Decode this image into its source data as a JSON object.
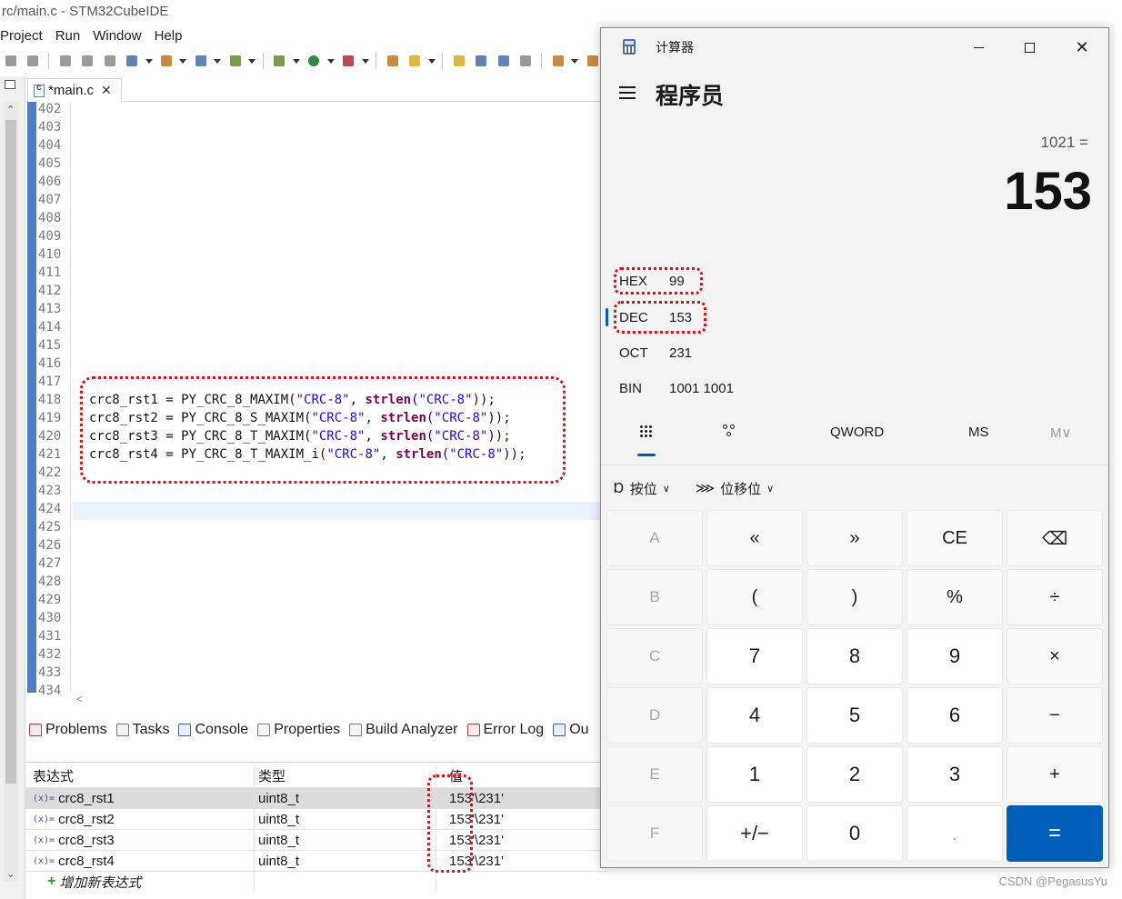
{
  "ide": {
    "title": "rc/main.c - STM32CubeIDE",
    "menu": [
      "Project",
      "Run",
      "Window",
      "Help"
    ],
    "editor_tab": "*main.c",
    "line_numbers": [
      "402",
      "403",
      "404",
      "405",
      "406",
      "407",
      "408",
      "409",
      "410",
      "411",
      "412",
      "413",
      "414",
      "415",
      "416",
      "417",
      "418",
      "419",
      "420",
      "421",
      "422",
      "423",
      "424",
      "425",
      "426",
      "427",
      "428",
      "429",
      "430",
      "431",
      "432",
      "433",
      "434"
    ],
    "code_lines": [
      {
        "line": "418",
        "var": "crc8_rst1",
        "fn": "PY_CRC_8_MAXIM"
      },
      {
        "line": "419",
        "var": "crc8_rst2",
        "fn": "PY_CRC_8_S_MAXIM"
      },
      {
        "line": "420",
        "var": "crc8_rst3",
        "fn": "PY_CRC_8_T_MAXIM"
      },
      {
        "line": "421",
        "var": "crc8_rst4",
        "fn": "PY_CRC_8_T_MAXIM_i"
      }
    ],
    "code_str": "\"CRC-8\"",
    "code_kw": "strlen",
    "panel_tabs": [
      "Problems",
      "Tasks",
      "Console",
      "Properties",
      "Build Analyzer",
      "Error Log",
      "Ou"
    ],
    "watch": {
      "headers": [
        "表达式",
        "类型",
        "值"
      ],
      "rows": [
        {
          "name": "crc8_rst1",
          "type": "uint8_t",
          "value": "153",
          "char": "'\\231'"
        },
        {
          "name": "crc8_rst2",
          "type": "uint8_t",
          "value": "153",
          "char": "'\\231'"
        },
        {
          "name": "crc8_rst3",
          "type": "uint8_t",
          "value": "153",
          "char": "'\\231'"
        },
        {
          "name": "crc8_rst4",
          "type": "uint8_t",
          "value": "153",
          "char": "'\\231'"
        }
      ],
      "add_label": "增加新表达式",
      "var_icon": "(x)="
    }
  },
  "calc": {
    "title": "计算器",
    "mode": "程序员",
    "expression": "1021 =",
    "result": "153",
    "radix": [
      {
        "label": "HEX",
        "value": "99"
      },
      {
        "label": "DEC",
        "value": "153"
      },
      {
        "label": "OCT",
        "value": "231"
      },
      {
        "label": "BIN",
        "value": "1001 1001"
      }
    ],
    "word_size": "QWORD",
    "ms": "MS",
    "mv": "M∨",
    "bitwise": "按位",
    "bitshift": "位移位",
    "keys": [
      [
        "A",
        "«",
        "»",
        "CE",
        "⌫"
      ],
      [
        "B",
        "(",
        ")",
        "%",
        "÷"
      ],
      [
        "C",
        "7",
        "8",
        "9",
        "×"
      ],
      [
        "D",
        "4",
        "5",
        "6",
        "−"
      ],
      [
        "E",
        "1",
        "2",
        "3",
        "+"
      ],
      [
        "F",
        "+/−",
        "0",
        ".",
        "="
      ]
    ]
  },
  "watermark": "CSDN @PegasusYu",
  "colors": {
    "accent": "#005fb8",
    "highlight": "#e0101a"
  }
}
